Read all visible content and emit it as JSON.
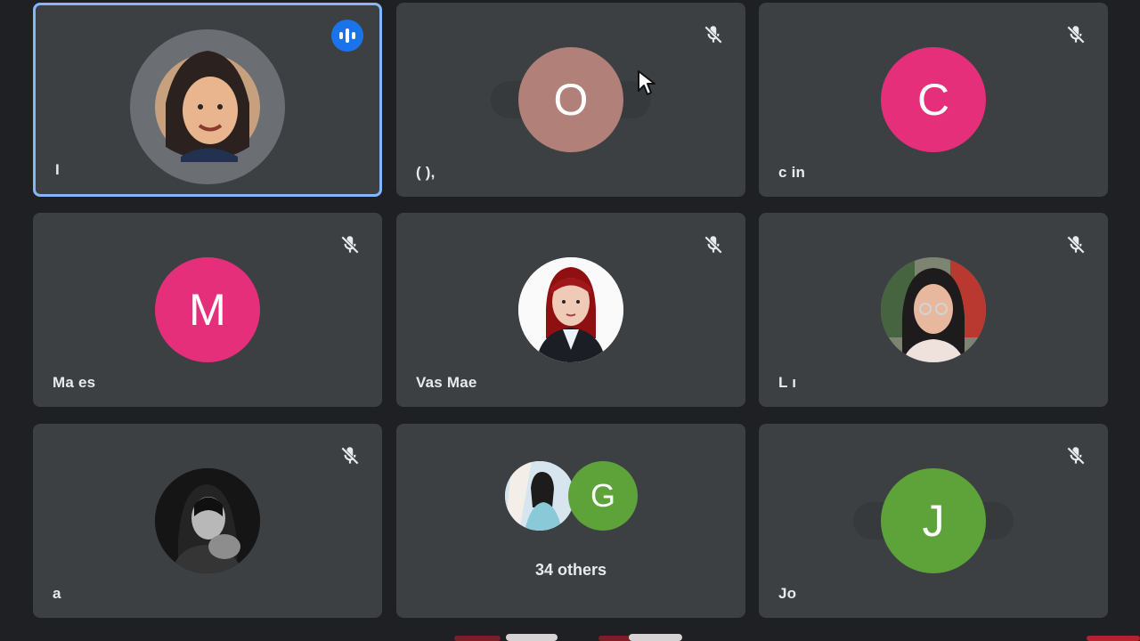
{
  "colors": {
    "background": "#1f2023",
    "tile": "#3c4043",
    "active_border": "#8ab4f8",
    "pink_avatar": "#e52f7b",
    "green_avatar": "#5ea33a",
    "orange_avatar": "#b08079",
    "speaker_badge": "#1a73e8"
  },
  "tiles": [
    {
      "name": "I",
      "avatar_kind": "photo",
      "active": true,
      "status_icon": "speaking-icon"
    },
    {
      "name": "(                               ),",
      "avatar_kind": "letter",
      "avatar_letter": "O",
      "status_icon": "mic-off-icon"
    },
    {
      "name": "c                                in",
      "avatar_kind": "letter",
      "avatar_letter": "C",
      "status_icon": "mic-off-icon"
    },
    {
      "name": "Ma                            es",
      "avatar_kind": "letter",
      "avatar_letter": "M",
      "status_icon": "mic-off-icon"
    },
    {
      "name": "Vas                            Mae",
      "avatar_kind": "photo",
      "status_icon": "mic-off-icon"
    },
    {
      "name": "L                                  ı",
      "avatar_kind": "photo",
      "status_icon": "mic-off-icon"
    },
    {
      "name": "a",
      "avatar_kind": "photo",
      "status_icon": "mic-off-icon"
    },
    {
      "name": "34 others",
      "avatar_kind": "group",
      "group_letter": "G",
      "status_icon": ""
    },
    {
      "name": "Jo",
      "avatar_kind": "letter",
      "avatar_letter": "J",
      "status_icon": "mic-off-icon"
    }
  ]
}
